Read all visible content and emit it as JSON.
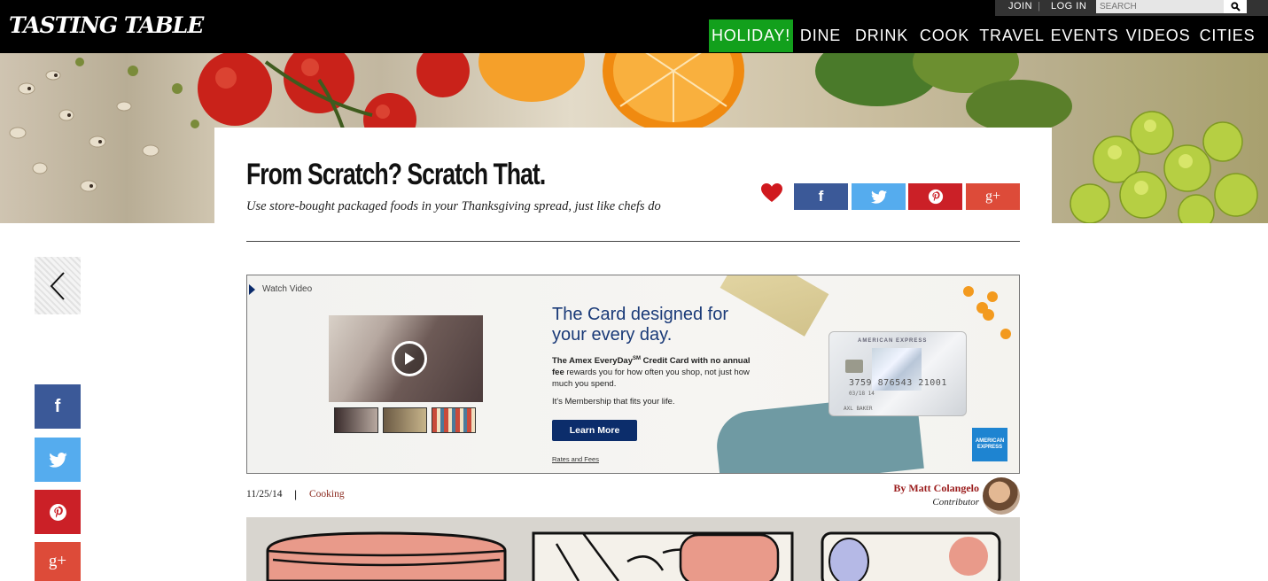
{
  "header": {
    "logo": "TASTING TABLE",
    "utility": {
      "join": "JOIN",
      "separator": "|",
      "login": "LOG IN"
    },
    "search": {
      "placeholder": "SEARCH"
    },
    "nav": [
      "HOLIDAY!",
      "DINE",
      "DRINK",
      "COOK",
      "TRAVEL",
      "EVENTS",
      "VIDEOS",
      "CITIES"
    ]
  },
  "article": {
    "title": "From Scratch? Scratch That.",
    "subtitle": "Use store-bought packaged foods in your Thanksgiving spread, just like chefs do",
    "date": "11/25/14",
    "separator": "|",
    "category": "Cooking",
    "byline": "By Matt Colangelo",
    "role": "Contributor"
  },
  "share": {
    "facebook": "f",
    "twitter": "twitter",
    "pinterest": "P",
    "googleplus": "g+"
  },
  "ad": {
    "watch": "Watch Video",
    "headline": "The Card designed for your every day.",
    "body_bold": "The Amex EveryDay",
    "body_sm": "SM",
    "body_bold2": " Credit Card with no annual fee",
    "body_rest": " rewards you for how often you shop, not just how much you spend.",
    "tagline": "It's Membership that fits your life.",
    "cta": "Learn More",
    "rates": "Rates and Fees",
    "card_brand": "AMERICAN EXPRESS",
    "card_number": "3759 876543 21001",
    "card_exp": "03/18          14",
    "card_name": "AXL BAKER",
    "logo_text": "AMERICAN EXPRESS"
  },
  "colors": {
    "nav_bg": "#000000",
    "holiday": "#12a01c",
    "facebook": "#3b5998",
    "twitter": "#55acee",
    "pinterest": "#cb2027",
    "googleplus": "#dd4b39",
    "heart": "#d0191e",
    "amex_blue": "#0c2d6b"
  }
}
